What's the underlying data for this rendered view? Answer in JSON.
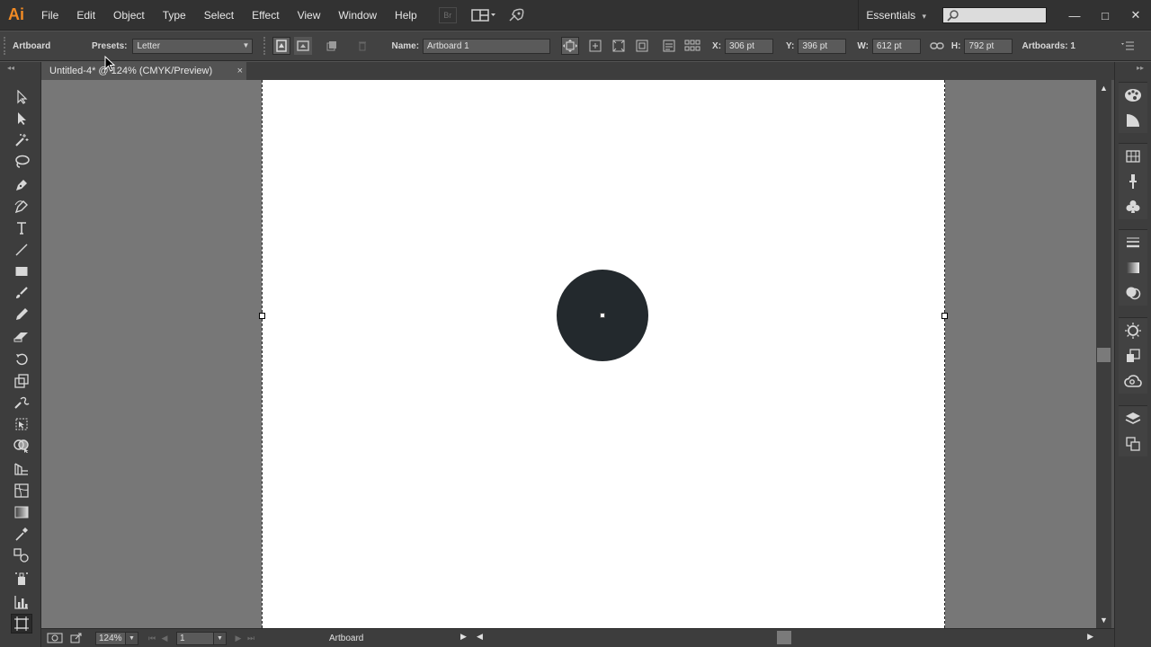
{
  "app": {
    "logo": "Ai",
    "brand_color": "#f08a24"
  },
  "menu": [
    {
      "label": "File"
    },
    {
      "label": "Edit"
    },
    {
      "label": "Object"
    },
    {
      "label": "Type"
    },
    {
      "label": "Select"
    },
    {
      "label": "Effect"
    },
    {
      "label": "View"
    },
    {
      "label": "Window"
    },
    {
      "label": "Help"
    }
  ],
  "menubar_icons": {
    "bridge": "Br"
  },
  "workspace": {
    "label": "Essentials",
    "arrow": "▾"
  },
  "window_controls": {
    "minimize": "—",
    "maximize": "□",
    "close": "✕"
  },
  "controlbar": {
    "tool_name": "Artboard",
    "presets_label": "Presets:",
    "presets_value": "Letter",
    "name_label": "Name:",
    "name_value": "Artboard 1",
    "x_label": "X:",
    "x_value": "306 pt",
    "y_label": "Y:",
    "y_value": "396 pt",
    "w_label": "W:",
    "w_value": "612 pt",
    "h_label": "H:",
    "h_value": "792 pt",
    "artboards_label": "Artboards: 1"
  },
  "document_tab": {
    "title": "Untitled-4* @ 124% (CMYK/Preview)",
    "close": "×"
  },
  "tools": [
    "selection-tool-icon",
    "direct-selection-tool-icon",
    "magic-wand-tool-icon",
    "lasso-tool-icon",
    "pen-tool-icon",
    "curvature-pen-tool-icon",
    "type-tool-icon",
    "line-segment-tool-icon",
    "rectangle-tool-icon",
    "paintbrush-tool-icon",
    "pencil-tool-icon",
    "eraser-tool-icon",
    "rotate-tool-icon",
    "scale-tool-icon",
    "warp-tool-icon",
    "free-transform-tool-icon",
    "shape-builder-tool-icon",
    "perspective-grid-tool-icon",
    "mesh-tool-icon",
    "gradient-tool-icon",
    "eyedropper-tool-icon",
    "blend-tool-icon",
    "symbol-sprayer-tool-icon",
    "column-graph-tool-icon",
    "artboard-tool-icon"
  ],
  "canvas": {
    "shape_color": "#23292d",
    "pasteboard_color": "#777777"
  },
  "statusbar": {
    "zoom_value": "124%",
    "artboard_number": "1",
    "status_text": "Artboard"
  }
}
